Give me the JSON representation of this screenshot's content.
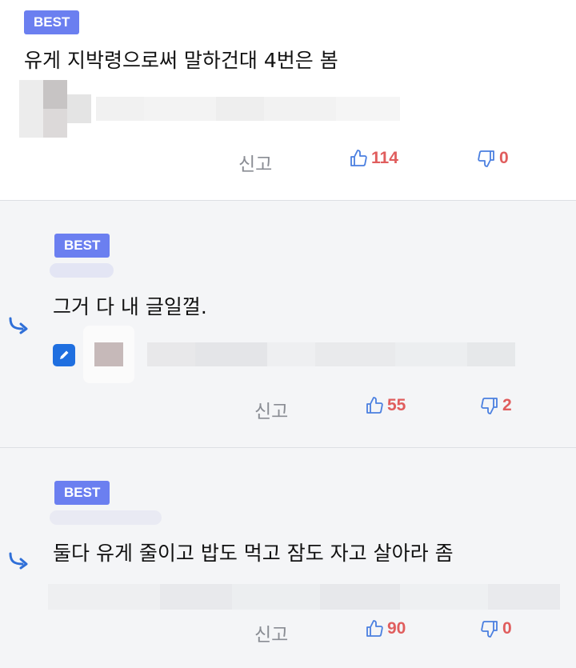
{
  "colors": {
    "badge": "#6b7ff0",
    "like": "#e05d5d",
    "icon": "#4a7fe0",
    "report": "#8a8d94"
  },
  "comments": [
    {
      "badge": "BEST",
      "text": "유게 지박령으로써 말하건대 4번은 봄",
      "report_label": "신고",
      "likes": "114",
      "dislikes": "0"
    },
    {
      "badge": "BEST",
      "text": "그거 다 내 글일껄.",
      "report_label": "신고",
      "likes": "55",
      "dislikes": "2",
      "is_reply": true
    },
    {
      "badge": "BEST",
      "text": "둘다 유게 줄이고 밥도 먹고 잠도 자고 살아라 좀",
      "report_label": "신고",
      "likes": "90",
      "dislikes": "0",
      "is_reply": true
    }
  ],
  "icons": {
    "like": "thumbs-up-icon",
    "dislike": "thumbs-down-icon",
    "reply": "reply-arrow-icon",
    "edit": "pencil-icon"
  }
}
